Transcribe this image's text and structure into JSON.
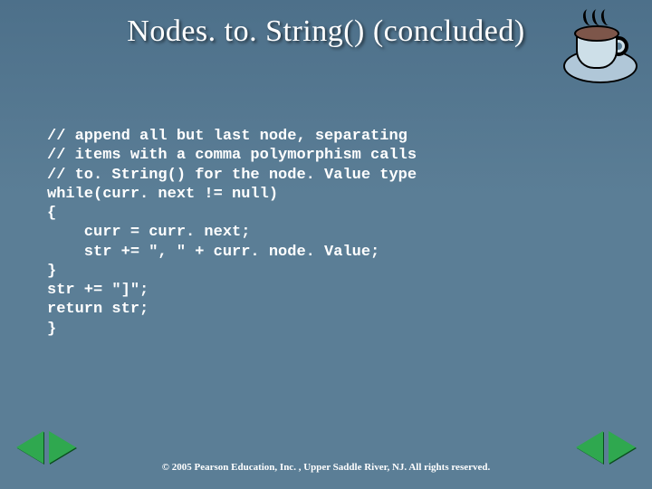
{
  "title": "Nodes. to. String() (concluded)",
  "code": "// append all but last node, separating\n// items with a comma polymorphism calls\n// to. String() for the node. Value type\nwhile(curr. next != null)\n{\n    curr = curr. next;\n    str += \", \" + curr. node. Value;\n}\nstr += \"]\";\nreturn str;\n}",
  "footer": "© 2005 Pearson Education, Inc. , Upper Saddle River, NJ.  All rights reserved."
}
